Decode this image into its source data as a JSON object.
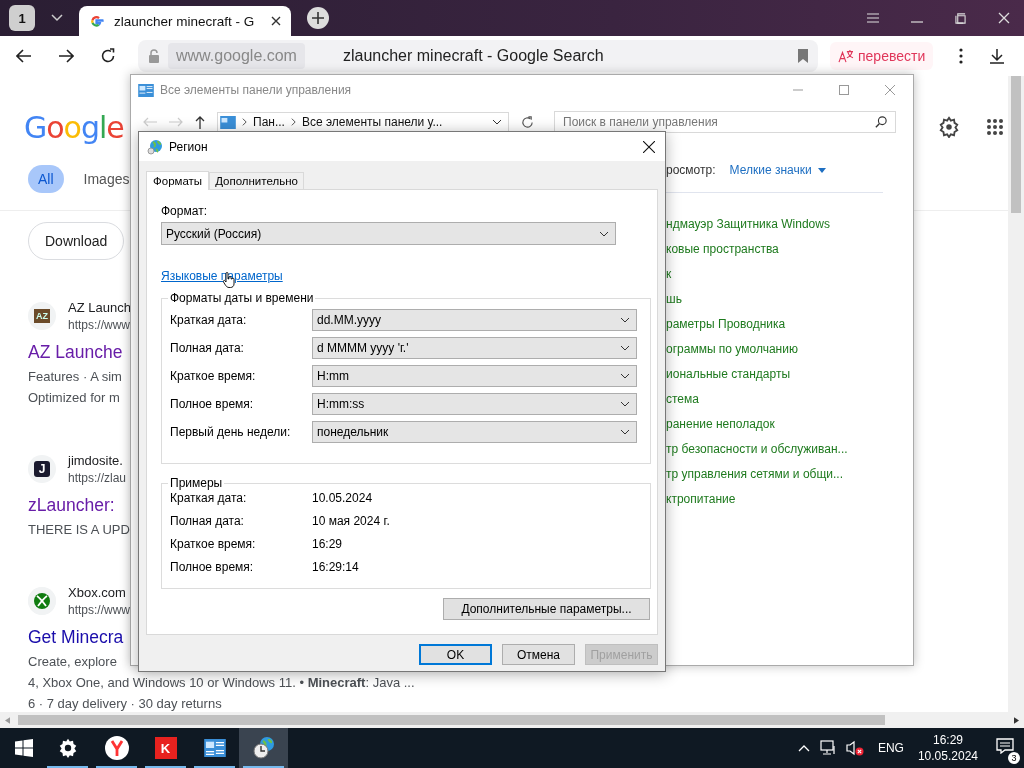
{
  "browser": {
    "tab_count": "1",
    "tab_title": "zlauncher minecraft - G",
    "url_domain": "www.google.com",
    "page_title": "zlauncher minecraft - Google Search",
    "translate_label": "перевести"
  },
  "google": {
    "logo": "Google",
    "filters": [
      {
        "label": "All",
        "selected": true
      },
      {
        "label": "Images",
        "selected": false
      }
    ],
    "chips": [
      "Download"
    ],
    "results": [
      {
        "kind": "az",
        "favicon_text": "AZ",
        "site": "AZ Launch",
        "url": "https://www",
        "title": "AZ Launche",
        "visited": true,
        "snippet": [
          "Features · A sim",
          "Optimized for m"
        ]
      },
      {
        "kind": "letter",
        "favicon_text": "J",
        "site": "jimdosite.",
        "url": "https://zlau",
        "title": "zLauncher:",
        "visited": true,
        "snippet": [
          "THERE IS A UPD"
        ]
      },
      {
        "kind": "xbox",
        "site": "Xbox.com",
        "url": "https://www",
        "title": "Get Minecra",
        "visited": false,
        "snippet": [
          "Create, explore",
          "4, Xbox One, and Windows 10 or Windows 11. • **Minecraft**: Java ...",
          "6 · 7 day delivery · 30 day returns"
        ]
      }
    ]
  },
  "control_panel": {
    "title": "Все элементы панели управления",
    "breadcrumb": [
      "Пан...",
      "Все элементы панели у..."
    ],
    "search_placeholder": "Поиск в панели управления",
    "view_label": "росмотр:",
    "view_value": "Мелкие значки",
    "items": [
      "ндмауэр Защитника Windows",
      "ковые пространства",
      "к",
      "шь",
      "раметры Проводника",
      "ограммы по умолчанию",
      "иональные стандарты",
      "стема",
      "ранение неполадок",
      "тр безопасности и обслуживан...",
      "тр управления сетями и общи...",
      "ктропитание"
    ]
  },
  "dialog": {
    "title": "Регион",
    "tabs": [
      {
        "label": "Форматы",
        "selected": true
      },
      {
        "label": "Дополнительно",
        "selected": false
      }
    ],
    "format_label": "Формат:",
    "format_value": "Русский (Россия)",
    "language_link": "Языковые параметры",
    "formats_group": "Форматы даты и времени",
    "formats": [
      {
        "label": "Краткая дата:",
        "value": "dd.MM.yyyy"
      },
      {
        "label": "Полная дата:",
        "value": "d MMMM yyyy 'г.'"
      },
      {
        "label": "Краткое время:",
        "value": "H:mm"
      },
      {
        "label": "Полное время:",
        "value": "H:mm:ss"
      },
      {
        "label": "Первый день недели:",
        "value": "понедельник"
      }
    ],
    "examples_group": "Примеры",
    "examples": [
      {
        "label": "Краткая дата:",
        "value": "10.05.2024"
      },
      {
        "label": "Полная дата:",
        "value": "10 мая 2024 г."
      },
      {
        "label": "Краткое время:",
        "value": "16:29"
      },
      {
        "label": "Полное время:",
        "value": "16:29:14"
      }
    ],
    "advanced_button": "Дополнительные параметры...",
    "buttons": [
      {
        "label": "OK",
        "kind": "default"
      },
      {
        "label": "Отмена",
        "kind": "normal"
      },
      {
        "label": "Применить",
        "kind": "disabled"
      }
    ]
  },
  "taskbar": {
    "apps": [
      {
        "kind": "settings",
        "running": true,
        "active": false
      },
      {
        "kind": "yandex",
        "running": true,
        "active": false
      },
      {
        "kind": "kl",
        "label": "K",
        "running": true,
        "active": false
      },
      {
        "kind": "control-panel",
        "running": true,
        "active": false
      },
      {
        "kind": "region",
        "running": true,
        "active": true
      }
    ],
    "language": "ENG",
    "time": "16:29",
    "date": "10.05.2024",
    "notifications": "3"
  }
}
